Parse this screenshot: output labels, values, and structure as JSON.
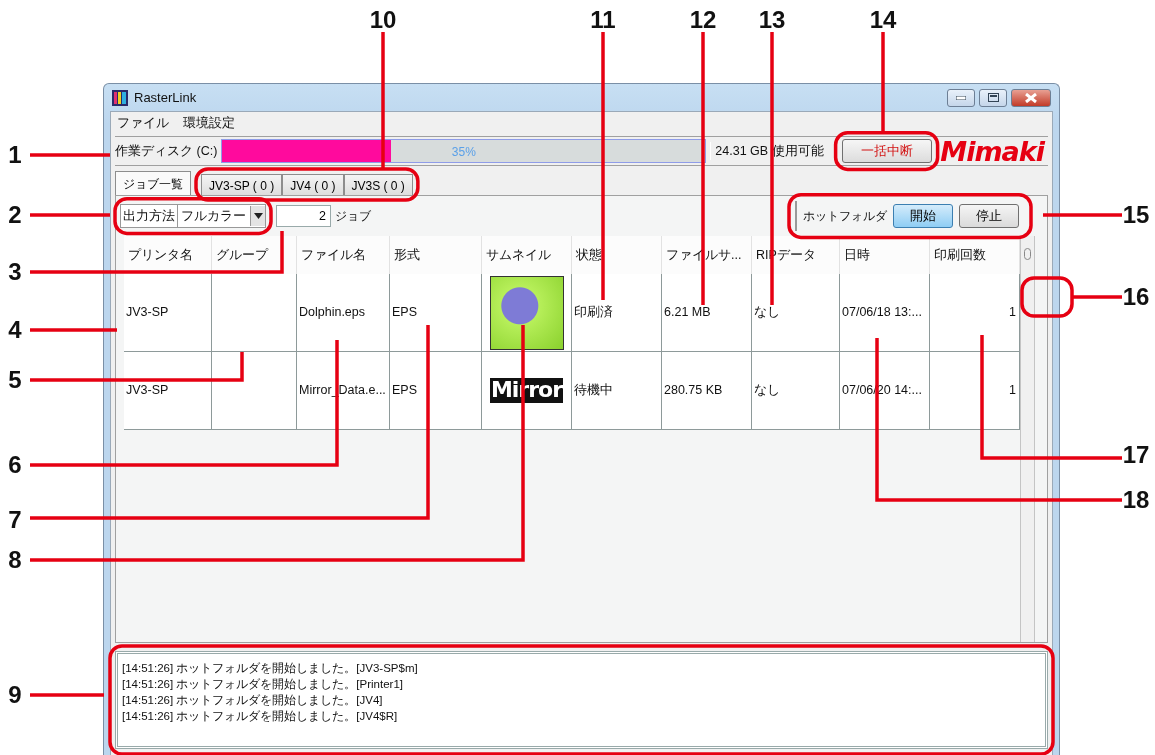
{
  "window": {
    "title": "RasterLink"
  },
  "menu": [
    "ファイル",
    "環境設定"
  ],
  "disk": {
    "label": "作業ディスク (C:)",
    "level": 0.35,
    "percent": "35%",
    "free": "24.31 GB 使用可能"
  },
  "stop_all_button": "一括中断",
  "logo": "Mimaki",
  "tabs": [
    {
      "label": "ジョブ一覧",
      "selected": true
    },
    {
      "label": "JV3-SP ( 0 )",
      "selected": false
    },
    {
      "label": "JV4 ( 0 )",
      "selected": false
    },
    {
      "label": "JV3S ( 0 )",
      "selected": false
    }
  ],
  "output": {
    "label": "出力方法",
    "value": "フルカラー"
  },
  "job_count": {
    "value": "2",
    "unit": "ジョブ"
  },
  "hot_folder": {
    "label": "ホットフォルダ",
    "buttons": [
      {
        "label": "開始",
        "active": true
      },
      {
        "label": "停止",
        "active": false
      }
    ]
  },
  "table": {
    "columns": [
      "プリンタ名",
      "グループ",
      "ファイル名",
      "形式",
      "サムネイル",
      "状態",
      "ファイルサ...",
      "RIPデータ",
      "日時",
      "印刷回数"
    ],
    "rows": [
      {
        "printer": "JV3-SP",
        "file": "Dolphin.eps",
        "format": "EPS",
        "thumbnail": {
          "kind": "photo"
        },
        "status": "印刷済",
        "size": "6.21 MB",
        "rip": "なし",
        "date": "07/06/18 13:...",
        "count": "1"
      },
      {
        "printer": "JV3-SP",
        "file": "Mirror_Data.e...",
        "format": "EPS",
        "thumbnail": {
          "kind": "text",
          "text": "Mirror"
        },
        "status": "待機中",
        "size": "280.75 KB",
        "rip": "なし",
        "date": "07/06/20 14:...",
        "count": "1"
      }
    ]
  },
  "log": [
    "[14:51:26] ホットフォルダを開始しました。[JV3-SP$m]",
    "[14:51:26] ホットフォルダを開始しました。[Printer1]",
    "[14:51:26] ホットフォルダを開始しました。[JV4]",
    "[14:51:26] ホットフォルダを開始しました。[JV4$R]"
  ],
  "callouts": [
    "1",
    "2",
    "3",
    "4",
    "5",
    "6",
    "7",
    "8",
    "9",
    "10",
    "11",
    "12",
    "13",
    "14",
    "15",
    "16",
    "17",
    "18"
  ]
}
